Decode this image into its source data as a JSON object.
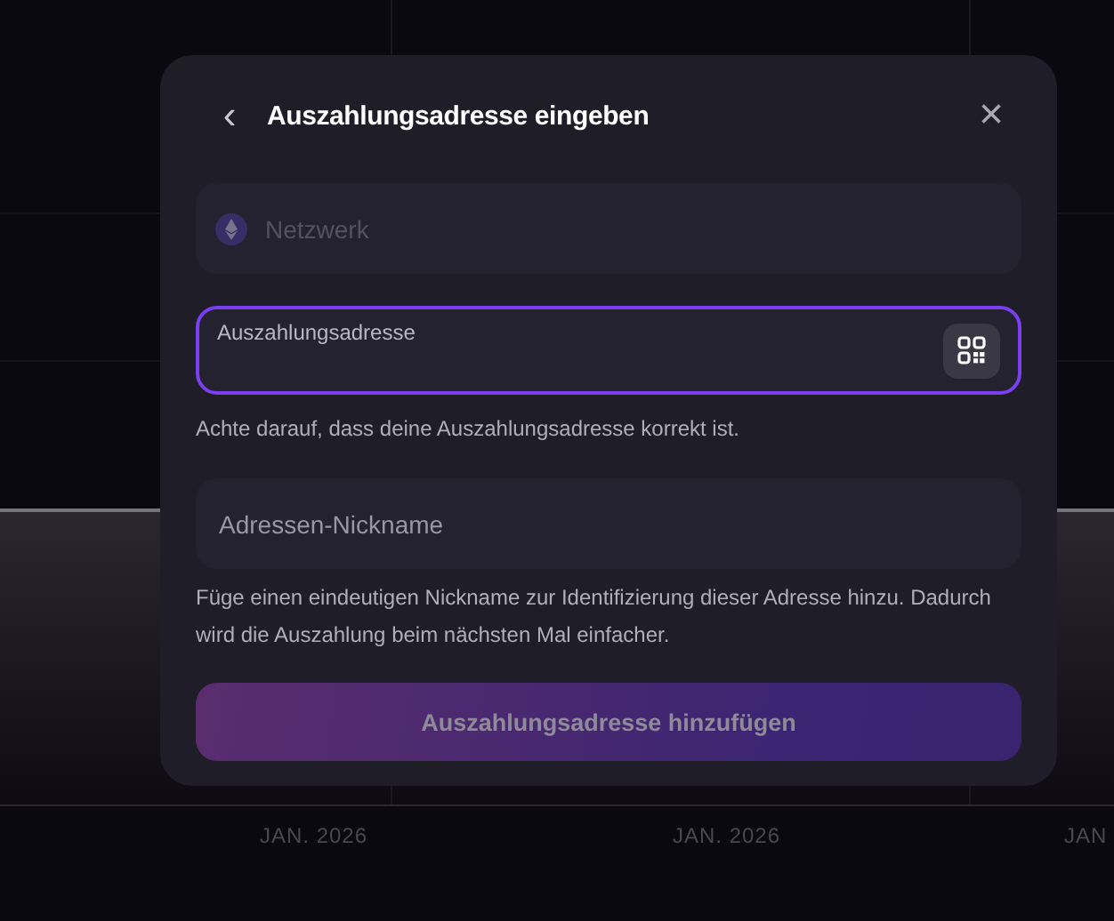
{
  "background_chart": {
    "x_labels": [
      "JAN. 2026",
      "JAN. 2026",
      "JAN"
    ]
  },
  "dialog": {
    "back": "‹",
    "title": "Auszahlungsadresse eingeben",
    "close": "×",
    "network_field": {
      "placeholder": "Netzwerk",
      "disabled": true
    },
    "address_field": {
      "label": "Auszahlungsadresse",
      "focused": true,
      "hint": "Achte darauf, dass deine Auszahlungsadresse korrekt ist."
    },
    "nickname_field": {
      "placeholder": "Adressen-Nickname",
      "hint": "Füge einen eindeutigen Nickname zur Identifizierung dieser Adresse hinzu. Dadurch wird die Auszahlung beim nächsten Mal einfacher."
    },
    "submit_button": {
      "label": "Auszahlungsadresse hinzufügen",
      "disabled": true
    }
  }
}
